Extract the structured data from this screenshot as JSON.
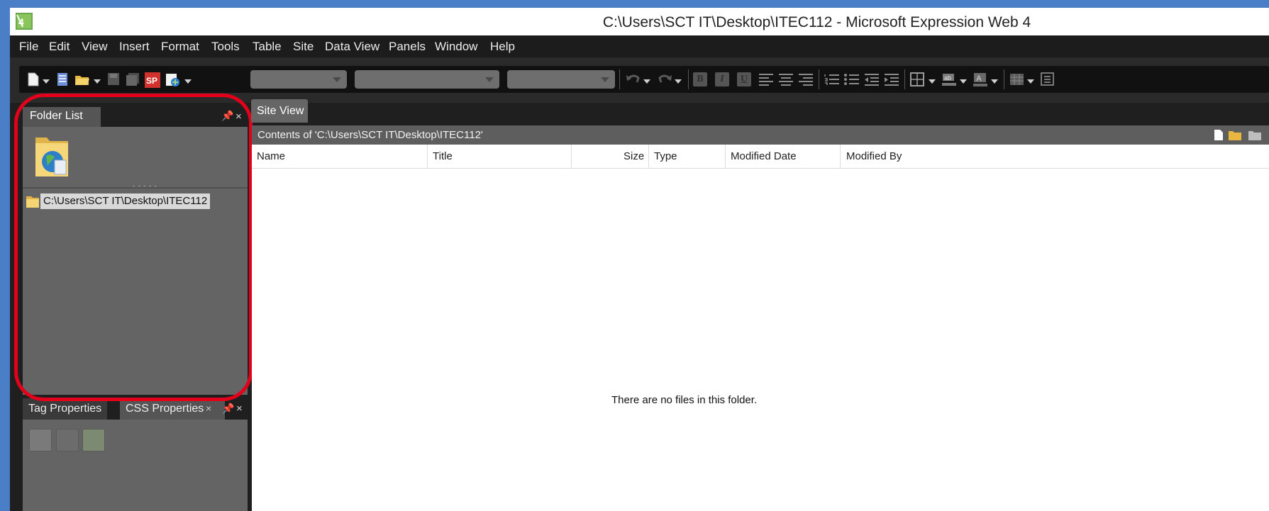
{
  "window": {
    "title": "C:\\Users\\SCT IT\\Desktop\\ITEC112 - Microsoft Expression Web 4",
    "app_icon": "expression-web-4-icon"
  },
  "menu": [
    "File",
    "Edit",
    "View",
    "Insert",
    "Format",
    "Tools",
    "Table",
    "Site",
    "Data View",
    "Panels",
    "Window",
    "Help"
  ],
  "toolbar": {
    "icons": [
      "new-page-icon",
      "new-page-dropdown",
      "page-icon",
      "open-folder-icon",
      "open-dropdown",
      "save-icon",
      "save-all-icon",
      "sharepoint-icon",
      "preview-icon",
      "preview-dropdown"
    ],
    "style_combo": "",
    "font_combo": "",
    "size_combo": "",
    "format_buttons": [
      "B",
      "I",
      "U"
    ]
  },
  "folder_list": {
    "tab_label": "Folder List",
    "root_path": "C:\\Users\\SCT IT\\Desktop\\ITEC112"
  },
  "bottom_panel": {
    "tabs": [
      "Tag Properties",
      "CSS Properties"
    ],
    "close_glyph": "×"
  },
  "site_view": {
    "tab_label": "Site View",
    "contents_label": "Contents of 'C:\\Users\\SCT IT\\Desktop\\ITEC112'",
    "columns": [
      "Name",
      "Title",
      "Size",
      "Type",
      "Modified Date",
      "Modified By"
    ],
    "empty_message": "There are no files in this folder."
  },
  "annotation": {
    "highlight_color": "#e3001b"
  }
}
